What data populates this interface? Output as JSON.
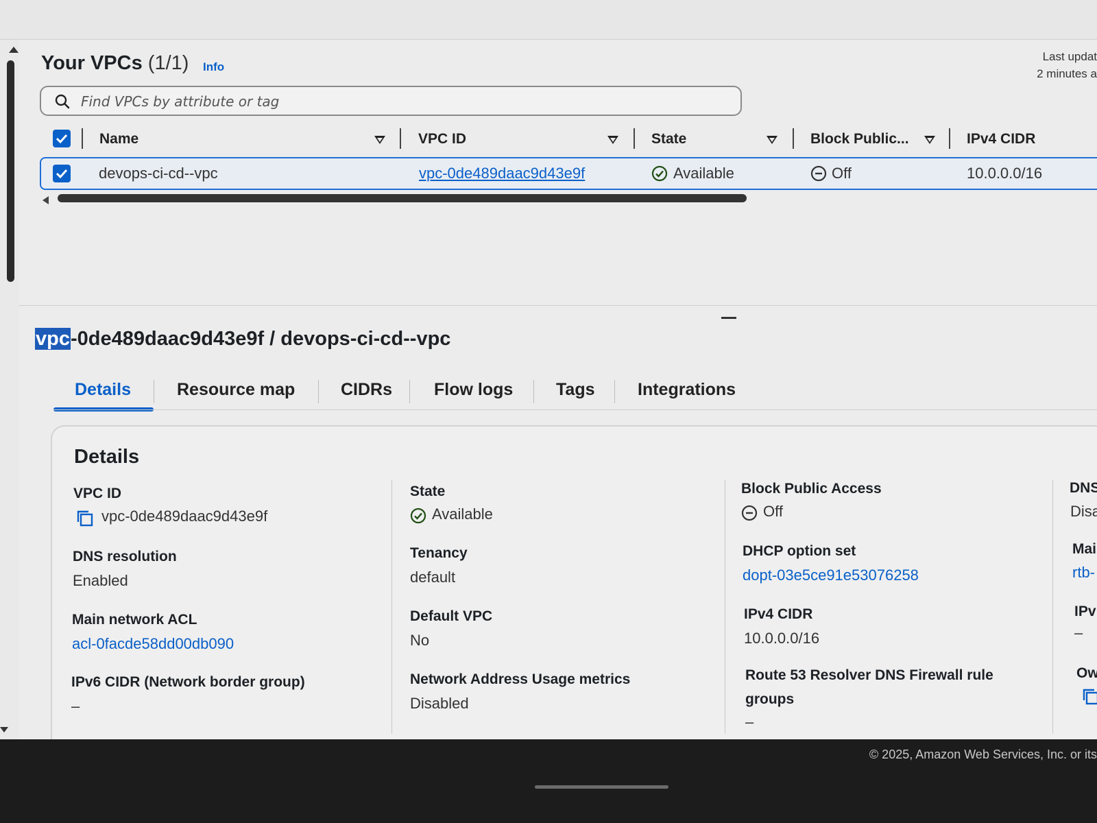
{
  "list": {
    "title": "Your VPCs",
    "count": "(1/1)",
    "info": "Info",
    "last_updated_1": "Last updat",
    "last_updated_2": "2 minutes a",
    "search_placeholder": "Find VPCs by attribute or tag",
    "columns": [
      "Name",
      "VPC ID",
      "State",
      "Block Public...",
      "IPv4 CIDR"
    ],
    "row": {
      "name": "devops-ci-cd--vpc",
      "vpc_id": "vpc-0de489daac9d43e9f",
      "state": "Available",
      "block_public": "Off",
      "ipv4_cidr": "10.0.0.0/16"
    }
  },
  "detail": {
    "title_highlight": "vpc",
    "title_rest": "-0de489daac9d43e9f / devops-ci-cd--vpc",
    "tabs": [
      "Details",
      "Resource map",
      "CIDRs",
      "Flow logs",
      "Tags",
      "Integrations"
    ],
    "heading": "Details",
    "fields": {
      "vpc_id_label": "VPC ID",
      "vpc_id_value": "vpc-0de489daac9d43e9f",
      "dns_resolution_label": "DNS resolution",
      "dns_resolution_value": "Enabled",
      "main_acl_label": "Main network ACL",
      "main_acl_value": "acl-0facde58dd00db090",
      "ipv6_cidr_label": "IPv6 CIDR (Network border group)",
      "ipv6_cidr_value": "–",
      "state_label": "State",
      "state_value": "Available",
      "tenancy_label": "Tenancy",
      "tenancy_value": "default",
      "default_vpc_label": "Default VPC",
      "default_vpc_value": "No",
      "nau_label": "Network Address Usage metrics",
      "nau_value": "Disabled",
      "bpa_label": "Block Public Access",
      "bpa_value": "Off",
      "dhcp_label": "DHCP option set",
      "dhcp_value": "dopt-03e5ce91e53076258",
      "ipv4_label": "IPv4 CIDR",
      "ipv4_value": "10.0.0.0/16",
      "r53_label_1": "Route 53 Resolver DNS Firewall rule",
      "r53_label_2": "groups",
      "r53_value": "–",
      "dns_hostnames_label": "DNS",
      "dns_hostnames_value": "Disa",
      "main_rt_label": "Mai",
      "main_rt_value": "rtb-",
      "ipv6_pool_label": "IPv",
      "ipv6_pool_value": "–",
      "owner_label": "Ow"
    }
  },
  "footer": {
    "copyright": "© 2025, Amazon Web Services, Inc. or its"
  },
  "colors": {
    "accent": "#0a60c9",
    "status_ok": "#1d8102",
    "footer_bg": "#1c1c1c"
  },
  "icons": [
    "search-icon",
    "checkbox-checked-icon",
    "sort-down-icon",
    "check-circle-icon",
    "minus-circle-icon",
    "copy-icon"
  ]
}
